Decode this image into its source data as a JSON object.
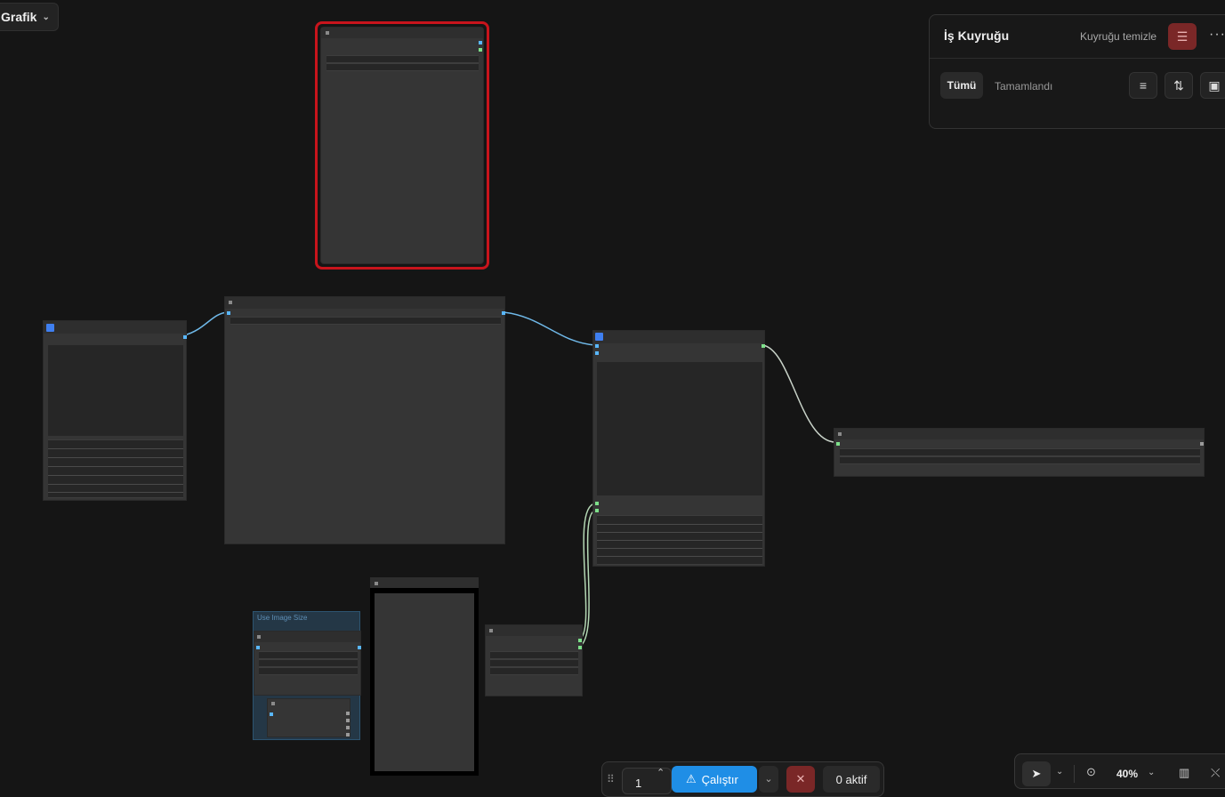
{
  "graph_menu": {
    "label": "Grafik",
    "chevron": "chevron-down-icon"
  },
  "queue_panel": {
    "title": "İş Kuyruğu",
    "clear_label": "Kuyruğu temizle",
    "clear_icon": "clear-queue-icon",
    "more_icon": "more-icon",
    "tabs": [
      {
        "label": "Tümü",
        "active": true
      },
      {
        "label": "Tamamlandı",
        "active": false
      }
    ],
    "icons": [
      "filter-icon",
      "sort-icon",
      "image-icon"
    ]
  },
  "nodes": {
    "group_label": "Use Image Size"
  },
  "run_bar": {
    "count": "1",
    "run_label": "Çalıştır",
    "run_icon": "warning-icon",
    "active_label": "0 aktif"
  },
  "canvas_tools": {
    "zoom": "40%",
    "icons": [
      "pointer-icon",
      "fit-view-icon",
      "minimap-icon",
      "link-visibility-icon"
    ]
  },
  "colors": {
    "background": "#151515",
    "node": "#353535",
    "accent_blue": "#1f8ee6",
    "danger": "#7a2727",
    "selected_outline": "#c8141c",
    "link_blue": "#6fb8e8",
    "link_green": "#b4d8b4"
  }
}
